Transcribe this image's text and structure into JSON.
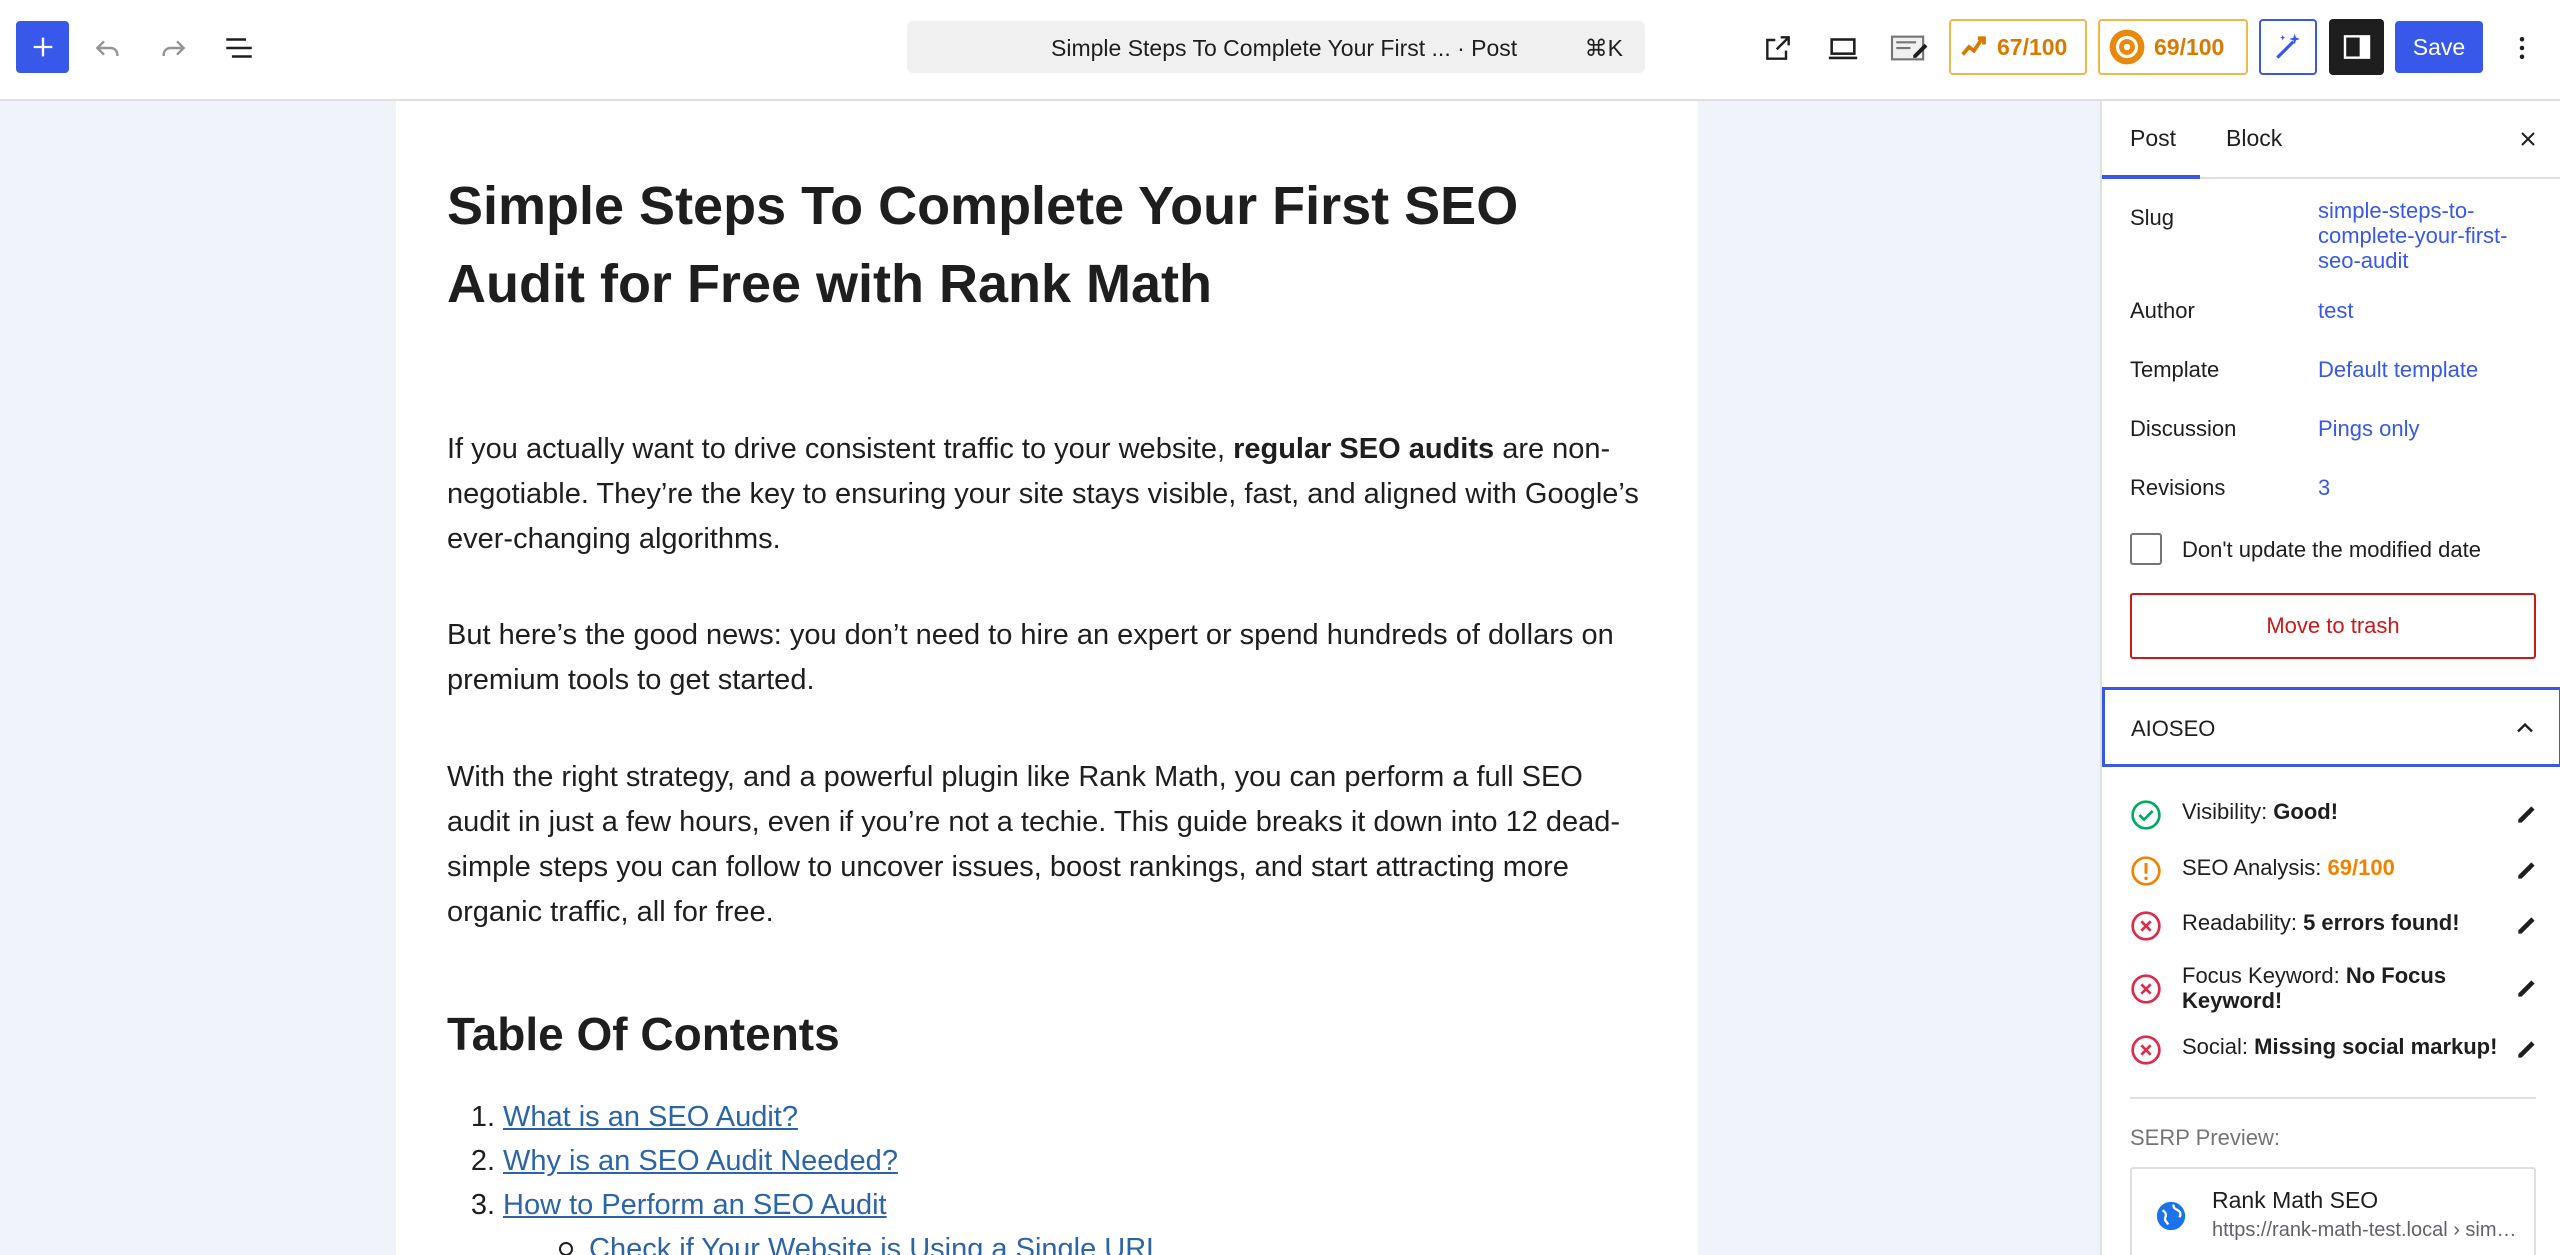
{
  "toolbar": {
    "command_title": "Simple Steps To Complete Your First ... · Post",
    "command_shortcut": "⌘K",
    "score_1": "67/100",
    "score_2": "69/100",
    "save_label": "Save"
  },
  "post": {
    "title": "Simple Steps To Complete Your First SEO Audit for Free with Rank Math",
    "p1_before": "If you actually want to drive consistent traffic to your website, ",
    "p1_bold": "regular SEO audits",
    "p1_after": " are non-negotiable. They’re the key to ensuring your site stays visible, fast, and aligned with Google’s ever-changing algorithms.",
    "p2": "But here’s the good news: you don’t need to hire an expert or spend hundreds of dollars on premium tools to get started.",
    "p3": "With the right strategy, and a powerful plugin like Rank Math, you can perform a full SEO audit in just a few hours, even if you’re not a techie. This guide breaks it down into 12 dead-simple steps you can follow to uncover issues, boost rankings, and start attracting more organic traffic, all for free.",
    "toc_heading": "Table Of Contents",
    "toc": [
      {
        "num": "1.",
        "label": "What is an SEO Audit?"
      },
      {
        "num": "2.",
        "label": "Why is an SEO Audit Needed?"
      },
      {
        "num": "3.",
        "label": "How to Perform an SEO Audit"
      }
    ],
    "toc_sub_1": "Check if Your Website is Using a Single URL"
  },
  "sidebar": {
    "tab_post": "Post",
    "tab_block": "Block",
    "slug_label": "Slug",
    "slug_value": "simple-steps-to-complete-your-first-seo-audit",
    "author_label": "Author",
    "author_value": "test",
    "template_label": "Template",
    "template_value": "Default template",
    "discussion_label": "Discussion",
    "discussion_value": "Pings only",
    "revisions_label": "Revisions",
    "revisions_value": "3",
    "modified_label": "Don't update the modified date",
    "trash_label": "Move to trash",
    "aioseo_title": "AIOSEO",
    "checks": [
      {
        "label": "Visibility: ",
        "value": "Good!"
      },
      {
        "label": "SEO Analysis: ",
        "value": "69/100"
      },
      {
        "label": "Readability: ",
        "value": "5 errors found!"
      },
      {
        "label": "Focus Keyword: ",
        "value": "No Focus Keyword!"
      },
      {
        "label": "Social: ",
        "value": "Missing social markup!"
      }
    ],
    "serp_label": "SERP Preview:",
    "serp_site": "Rank Math SEO",
    "serp_url": "https://rank-math-test.local › simple-steps"
  },
  "colors": {
    "accent": "#3858e9",
    "good": "#00aa63",
    "warning": "#f18200",
    "error": "#df2a4a",
    "danger": "#cc1818"
  }
}
